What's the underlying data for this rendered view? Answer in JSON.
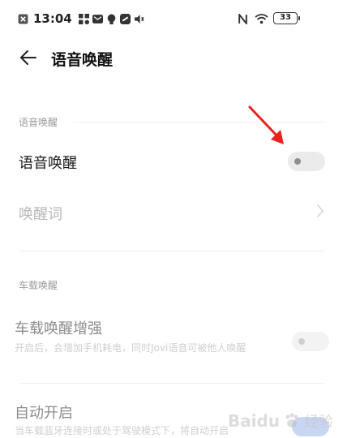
{
  "status_bar": {
    "time": "13:04",
    "battery": "33"
  },
  "header": {
    "title": "语音唤醒"
  },
  "sections": [
    {
      "label": "语音唤醒",
      "rows": [
        {
          "title": "语音唤醒",
          "control": "toggle",
          "state": "off"
        },
        {
          "title": "唤醒词",
          "control": "chevron",
          "state": "disabled"
        }
      ]
    },
    {
      "label": "车载唤醒",
      "rows": [
        {
          "title": "车载唤醒增强",
          "subtitle": "开启后，会增加手机耗电，同时Jovi语音可被他人唤醒",
          "control": "toggle",
          "state": "disabled"
        },
        {
          "title": "自动开启",
          "subtitle": "当车载蓝牙连接时或处于驾驶模式下，将自动开启",
          "control": "toggle",
          "state": "disabled-on"
        }
      ]
    }
  ],
  "annotation": {
    "arrow_color": "#e8231e"
  },
  "watermark": {
    "brand": "Baidu",
    "suffix": "经验"
  },
  "colors": {
    "text_primary": "#1a1a1a",
    "text_disabled": "#b8b8b8",
    "section_label": "#9a9a9a",
    "toggle_off": "#ebebeb"
  }
}
